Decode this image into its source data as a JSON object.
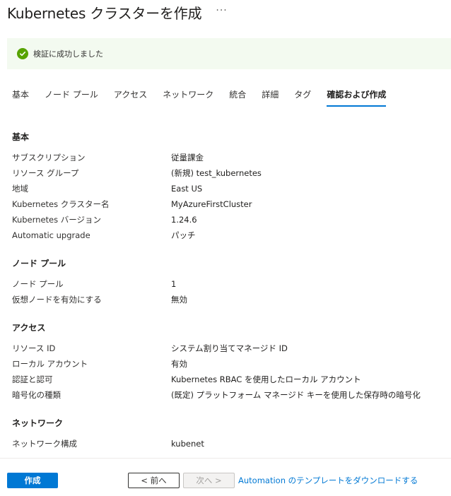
{
  "header": {
    "title": "Kubernetes クラスターを作成",
    "more": "···"
  },
  "banner": {
    "text": "検証に成功しました",
    "color": "#57a300"
  },
  "tabs": [
    {
      "label": "基本",
      "active": false
    },
    {
      "label": "ノード プール",
      "active": false
    },
    {
      "label": "アクセス",
      "active": false
    },
    {
      "label": "ネットワーク",
      "active": false
    },
    {
      "label": "統合",
      "active": false
    },
    {
      "label": "詳細",
      "active": false
    },
    {
      "label": "タグ",
      "active": false
    },
    {
      "label": "確認および作成",
      "active": true
    }
  ],
  "sections": [
    {
      "title": "基本",
      "rows": [
        {
          "label": "サブスクリプション",
          "value": "従量課金"
        },
        {
          "label": "リソース グループ",
          "value": "(新規) test_kubernetes"
        },
        {
          "label": "地域",
          "value": "East US"
        },
        {
          "label": "Kubernetes クラスター名",
          "value": "MyAzureFirstCluster"
        },
        {
          "label": "Kubernetes バージョン",
          "value": "1.24.6"
        },
        {
          "label": "Automatic upgrade",
          "value": "パッチ"
        }
      ]
    },
    {
      "title": "ノード プール",
      "rows": [
        {
          "label": "ノード プール",
          "value": "1"
        },
        {
          "label": "仮想ノードを有効にする",
          "value": "無効"
        }
      ]
    },
    {
      "title": "アクセス",
      "rows": [
        {
          "label": "リソース ID",
          "value": "システム割り当てマネージド ID"
        },
        {
          "label": "ローカル アカウント",
          "value": "有効"
        },
        {
          "label": "認証と認可",
          "value": "Kubernetes RBAC を使用したローカル アカウント"
        },
        {
          "label": "暗号化の種類",
          "value": "(既定) プラットフォーム マネージド キーを使用した保存時の暗号化"
        }
      ]
    },
    {
      "title": "ネットワーク",
      "rows": [
        {
          "label": "ネットワーク構成",
          "value": "kubenet"
        }
      ]
    }
  ],
  "footer": {
    "create_label": "作成",
    "prev_label": "< 前へ",
    "next_label": "次へ >",
    "download_link": "Automation のテンプレートをダウンロードする"
  },
  "colors": {
    "accent": "#0078d4",
    "success": "#57a300"
  }
}
